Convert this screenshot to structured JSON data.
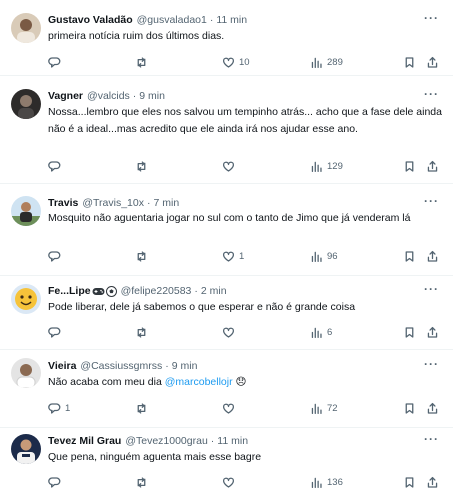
{
  "tweets": [
    {
      "name": "Gustavo Valadão",
      "handle": "@gusvaladao1",
      "dot": "·",
      "time": "11 min",
      "text": "primeira notícia ruim dos últimos dias.",
      "replies": "",
      "retweets": "",
      "likes": "10",
      "views": "289"
    },
    {
      "name": "Vagner",
      "handle": "@valcids",
      "dot": "·",
      "time": "9 min",
      "text": "Nossa...lembro que eles nos salvou um tempinho atrás... acho que a fase dele ainda não é a ideal...mas acredito que ele ainda irá nos ajudar esse ano.",
      "replies": "",
      "retweets": "",
      "likes": "",
      "views": "129"
    },
    {
      "name": "Travis",
      "handle": "@Travis_10x",
      "dot": "·",
      "time": "7 min",
      "text": "Mosquito não aguentaria jogar no sul com o tanto de Jimo que já venderam lá",
      "replies": "",
      "retweets": "",
      "likes": "1",
      "views": "96"
    },
    {
      "name": "Fe...Lipe",
      "handle": "@felipe220583",
      "dot": "·",
      "time": "2 min",
      "text": "Pode liberar, dele já sabemos o que esperar e não é grande coisa",
      "replies": "",
      "retweets": "",
      "likes": "",
      "views": "6"
    },
    {
      "name": "Vieira",
      "handle": "@Cassiussgmrss",
      "dot": "·",
      "time": "9 min",
      "text_prefix": "Não acaba com meu dia ",
      "mention": "@marcobellojr",
      "text_suffix": " 😞",
      "replies": "1",
      "retweets": "",
      "likes": "",
      "views": "72"
    },
    {
      "name": "Tevez Mil Grau",
      "handle": "@Tevez1000grau",
      "dot": "·",
      "time": "11 min",
      "text": "Que pena, ninguém aguenta mais esse bagre",
      "replies": "",
      "retweets": "",
      "likes": "",
      "views": "136"
    }
  ],
  "more_label": "···",
  "colors": {
    "muted": "#536471",
    "link": "#1d9bf0",
    "text": "#0f1419",
    "divider": "#eff3f4"
  },
  "icons": [
    "reply-icon",
    "retweet-icon",
    "like-icon",
    "views-icon",
    "bookmark-icon",
    "share-icon",
    "more-icon",
    "game-controller-icon",
    "soccer-ball-icon"
  ]
}
